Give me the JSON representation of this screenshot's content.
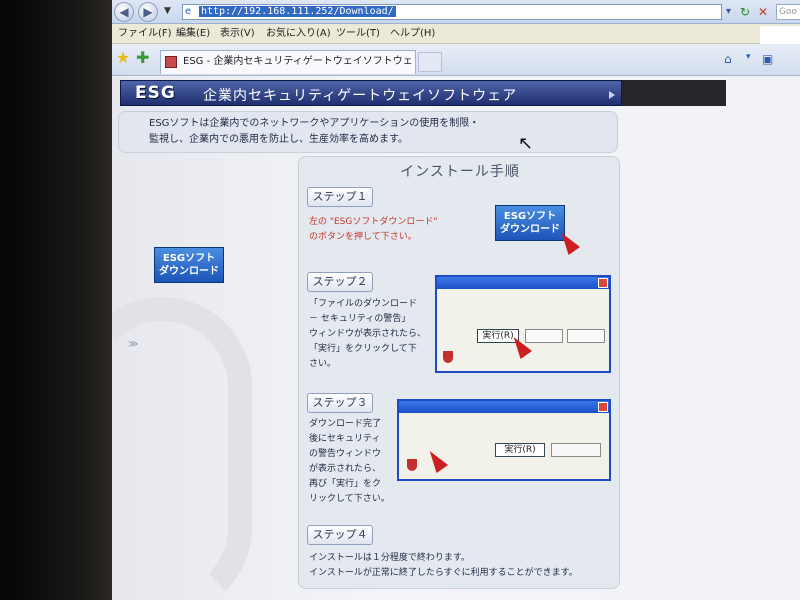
{
  "browser": {
    "url": "http://192.168.111.252/Download/",
    "menu": [
      "ファイル(F)",
      "編集(E)",
      "表示(V)",
      "お気に入り(A)",
      "ツール(T)",
      "ヘルプ(H)"
    ],
    "tab_title": "ESG - 企業内セキュリティゲートウェイソフトウェア",
    "search_placeholder": "Goo"
  },
  "banner": {
    "logo": "ESG",
    "title": "企業内セキュリティゲートウェイソフトウェア"
  },
  "intro": {
    "line1": "ESGソフトは企業内でのネットワークやアプリケーションの使用を制限・",
    "line2": "監視し、企業内での悪用を防止し、生産効率を高めます。"
  },
  "sidebar_download": {
    "line1": "ESGソフト",
    "line2": "ダウンロード"
  },
  "install": {
    "title": "インストール手順",
    "step1": {
      "label": "ステップ１",
      "line1": "左の \"ESGソフトダウンロード\"",
      "line2": "のボタンを押して下さい。",
      "button_line1": "ESGソフト",
      "button_line2": "ダウンロード"
    },
    "step2": {
      "label": "ステップ２",
      "lines": [
        "「ファイルのダウンロード",
        "－ セキュリティの警告」",
        "ウィンドウが表示されたら、",
        "「実行」をクリックして下",
        "さい。"
      ],
      "run_button": "実行(R)"
    },
    "step3": {
      "label": "ステップ３",
      "lines": [
        "ダウンロード完了",
        "後にセキュリティ",
        "の警告ウィンドウ",
        "が表示されたら、",
        "再び「実行」をク",
        "リックして下さい。"
      ],
      "run_button": "実行(R)"
    },
    "step4": {
      "label": "ステップ４",
      "line1": "インストールは１分程度で終わります。",
      "line2": "インストールが正常に終了したらすぐに利用することができます。"
    }
  },
  "colors": {
    "banner": "#1f2f6f",
    "download_button": "#2e6fd0",
    "step_text_red": "#c0392b"
  },
  "icons": [
    "back-icon",
    "forward-icon",
    "refresh-icon",
    "stop-icon",
    "favorites-star-icon",
    "add-favorite-icon",
    "home-icon",
    "mouse-cursor-icon"
  ]
}
